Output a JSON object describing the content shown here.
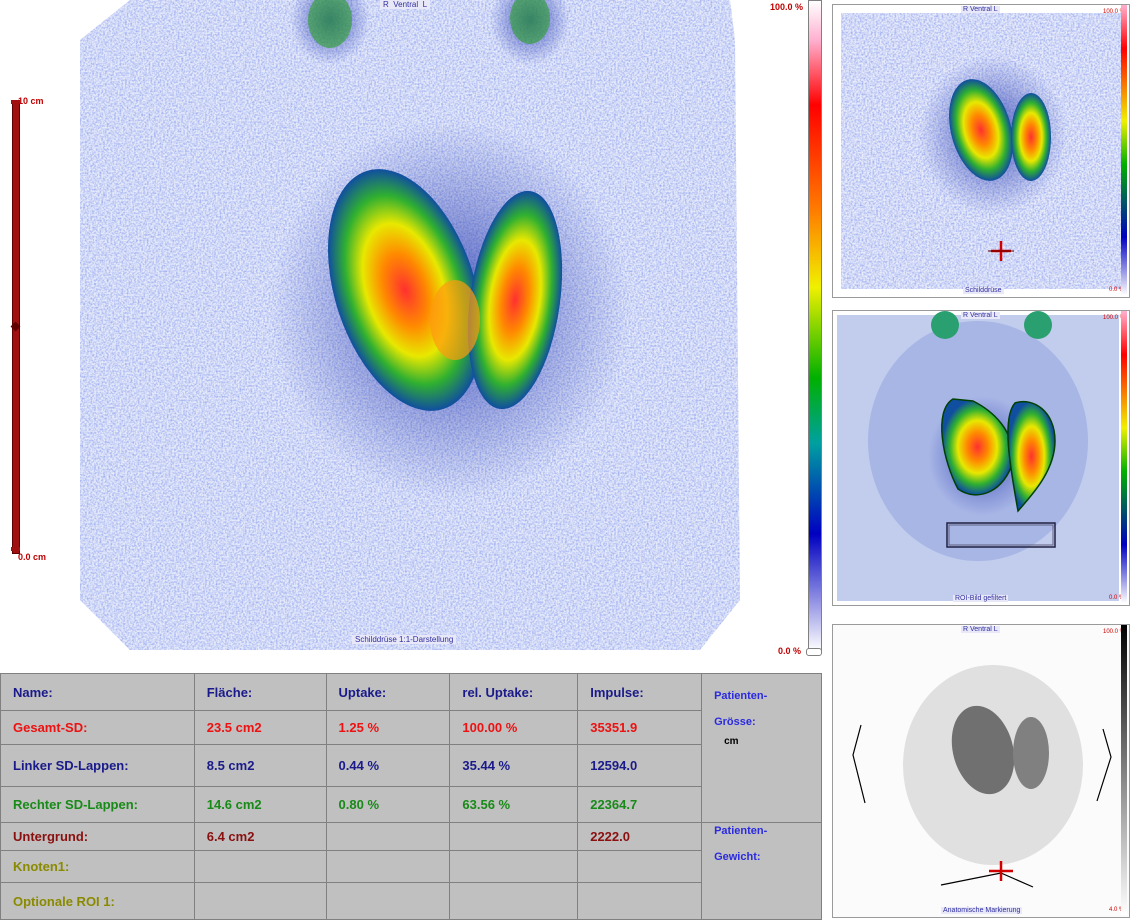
{
  "main_scan": {
    "orientation": {
      "r": "R",
      "view": "Ventral",
      "l": "L"
    },
    "caption": "Schilddrüse 1:1-Darstellung"
  },
  "ruler": {
    "top_label": "10 cm",
    "bottom_label": "0.0 cm"
  },
  "colorbar": {
    "max_label": "100.0 %",
    "min_label": "0.0 %"
  },
  "thumbnails": [
    {
      "orientation": "R   Ventral   L",
      "max_label": "100.0 %",
      "min_label": "0.0 %",
      "caption": "Schilddrüse"
    },
    {
      "orientation": "R   Ventral   L",
      "max_label": "100.0 %",
      "min_label": "0.0 %",
      "caption": "ROI-Bild gefiltert"
    },
    {
      "orientation": "R   Ventral   L",
      "max_label": "100.0 %",
      "min_label": "4.0 %",
      "caption": "Anatomische Markierung"
    }
  ],
  "table": {
    "headers": [
      "Name:",
      "Fläche:",
      "Uptake:",
      "rel. Uptake:",
      "Impulse:"
    ],
    "rows": [
      {
        "name": "Gesamt-SD:",
        "flaeche": "23.5 cm2",
        "uptake": "1.25 %",
        "rel_uptake": "100.00 %",
        "impulse": "35351.9",
        "color": "red"
      },
      {
        "name": "Linker SD-Lappen:",
        "flaeche": "8.5 cm2",
        "uptake": "0.44 %",
        "rel_uptake": "35.44 %",
        "impulse": "12594.0",
        "color": "navy"
      },
      {
        "name": "Rechter SD-Lappen:",
        "flaeche": "14.6 cm2",
        "uptake": "0.80 %",
        "rel_uptake": "63.56 %",
        "impulse": "22364.7",
        "color": "green"
      },
      {
        "name": "Untergrund:",
        "flaeche": "6.4 cm2",
        "uptake": "",
        "rel_uptake": "",
        "impulse": "2222.0",
        "color": "dred"
      },
      {
        "name": "Knoten1:",
        "flaeche": "",
        "uptake": "",
        "rel_uptake": "",
        "impulse": "",
        "color": "olive"
      },
      {
        "name": "Optionale ROI 1:",
        "flaeche": "",
        "uptake": "",
        "rel_uptake": "",
        "impulse": "",
        "color": "olive"
      }
    ],
    "patient": {
      "size_label_1": "Patienten-",
      "size_label_2": "Grösse:",
      "size_unit": "cm",
      "weight_label_1": "Patienten-",
      "weight_label_2": "Gewicht:"
    }
  },
  "colors": {
    "scan_blue": "#3a4fc8",
    "scan_green": "#2aa02a",
    "scan_yellow": "#e8e800",
    "scan_red": "#e03010",
    "table_bg": "#c0c0c0"
  }
}
